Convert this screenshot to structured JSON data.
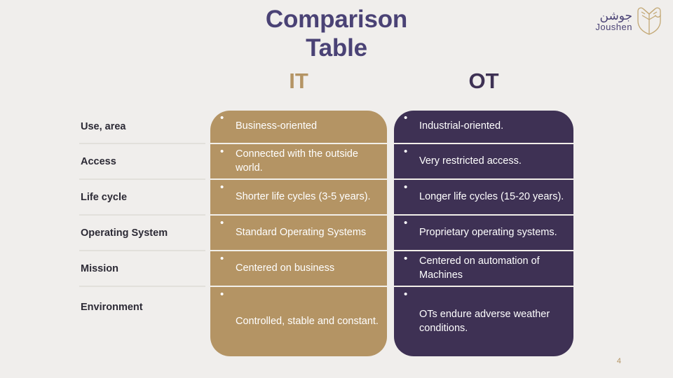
{
  "slide": {
    "background_color": "#F0EEEC",
    "title_lines": [
      "Comparison",
      "Table"
    ],
    "title_color": "#4A4275",
    "page_number": "4"
  },
  "logo": {
    "arabic": "جوشن",
    "latin": "Joushen",
    "mark_icon": "shield-armor-icon",
    "color": "#4A4275",
    "mark_color": "#C3A875"
  },
  "table": {
    "columns": [
      {
        "key": "label",
        "header": "",
        "color": ""
      },
      {
        "key": "it",
        "header": "IT",
        "color": "#B49464"
      },
      {
        "key": "ot",
        "header": "OT",
        "color": "#3E3154"
      }
    ],
    "rows": [
      {
        "label": "Use, area",
        "it": "Business-oriented",
        "ot": "Industrial-oriented."
      },
      {
        "label": "Access",
        "it": "Connected with the outside world.",
        "ot": "Very restricted access."
      },
      {
        "label": "Life cycle",
        "it": "Shorter life cycles (3-5 years).",
        "ot": "Longer life cycles (15-20 years)."
      },
      {
        "label": "Operating System",
        "it": "Standard Operating Systems",
        "ot": "Proprietary operating systems."
      },
      {
        "label": "Mission",
        "it": "Centered on business",
        "ot": "Centered on automation of Machines"
      },
      {
        "label": "Environment",
        "it": "Controlled, stable and constant.",
        "ot": "OTs endure adverse weather conditions."
      }
    ],
    "bullet_glyph": "•"
  }
}
